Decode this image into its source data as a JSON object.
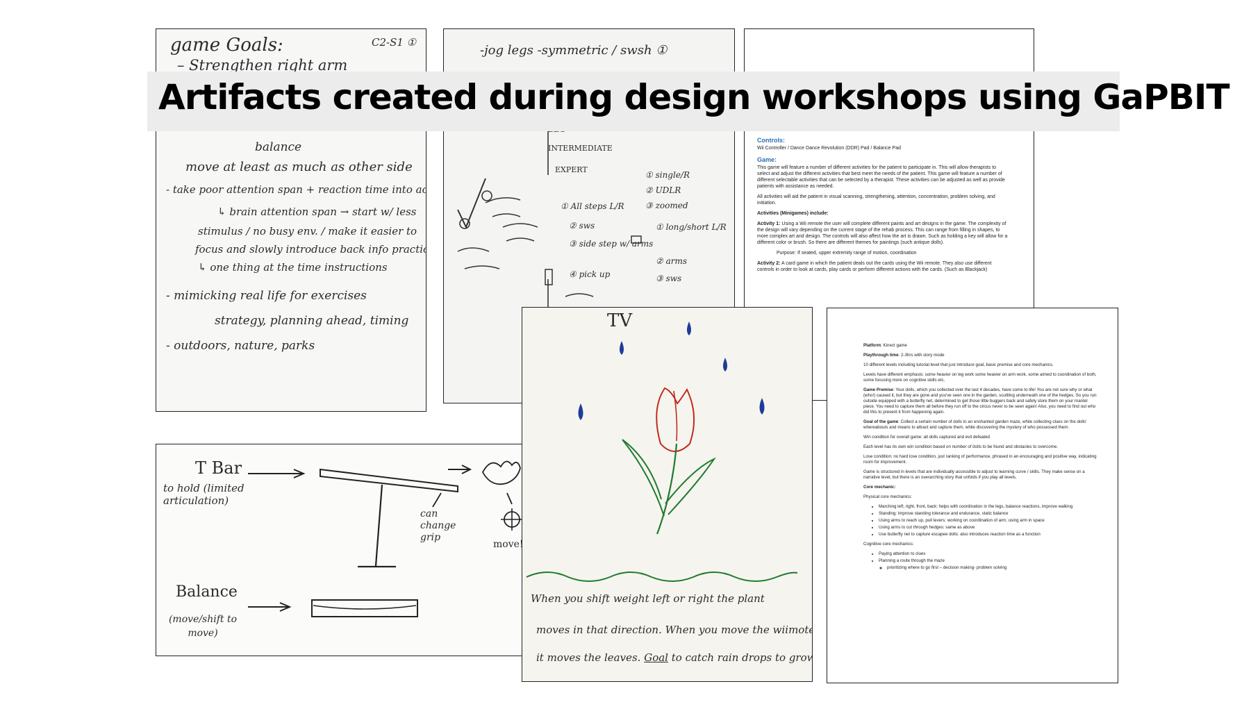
{
  "title": "Artifacts created during design workshops using GaPBIT",
  "panel1": {
    "lines": [
      "game Goals:",
      "C2-S1 ①",
      "– Strengthen right arm",
      "balance",
      "move at least as much as other side",
      "- take poor attention span + reaction time into account",
      "↳ brain attention span → start w/ less",
      "stimulus / no busy env. / make it easier to",
      "focus and slowly introduce back info practice",
      "↳ one thing at the time instructions",
      "- mimicking real life for exercises",
      "strategy, planning ahead, timing",
      "- outdoors, nature, parks"
    ]
  },
  "panel2": {
    "lines": [
      "-jog legs -symmetric / swsh ①",
      "BEG",
      "INTERMEDIATE",
      "EXPERT",
      "① All steps L/R",
      "② sws",
      "③ side step w/ arms",
      "④ pick up",
      "① single/R",
      "② UDLR",
      "③ zoomed",
      "① long/short L/R",
      "② arms",
      "③ sws"
    ]
  },
  "doc1": {
    "controls_heading": "Controls:",
    "controls_text": "Wii Controller / Dance Dance Revolution (DDR) Pad / Balance Pad",
    "game_heading": "Game:",
    "p1": "This game will feature a number of different activities for the patient to participate in. This will allow therapists to select and adjust the different activities that best meet the needs of the patient. This game will feature a number of different selectable activities that can be selected by a therapist. These activities can be adjusted as well as provide patients with assistance as needed.",
    "p2": "All activities will aid the patient in visual scanning, strengthening, attention, concentration, problem solving, and initiation.",
    "p3": "Activities (Minigames) include:",
    "p4_label": "Activity 1:",
    "p4": " Using a Wii remote the user will complete different paints and art designs in the game. The complexity of the design will vary depending on the current stage of the rehab process. This can range from filling in shapes, to more complex art and design. The controls will also affect how the art is drawn. Such as holding a key will allow for a different color or brush. So there are different themes for paintings (such antique dolls).",
    "p5": "Purpose: If seated, upper extremity range of motion, coordination",
    "p6_label": "Activity 2:",
    "p6": " A card game in which the patient deals out the cards using the Wii remote. They also use different controls in order to look at cards, play cards or perform different actions with the cards. (Such as Blackjack)"
  },
  "panel4": {
    "tbar_label": "T Bar",
    "tbar_note": "to hold (limited articulation)",
    "grip_note": "can change grip",
    "move_note": "move!",
    "balance_label": "Balance",
    "balance_note": "(move/shift to move)"
  },
  "panel5": {
    "tv_label": "TV",
    "caption_line1": "When you shift weight left or right the plant",
    "caption_line2": "moves in that direction. When you move the wiimote",
    "caption_line3_pre": "it moves the leaves.",
    "caption_goal": "Goal",
    "caption_line3_post": "to catch rain drops to grow"
  },
  "doc2": {
    "platform_label": "Platform",
    "platform": ": Kinect game",
    "playthrough_label": "Playthrough time",
    "playthrough": ": 2-3hrs with story mode",
    "p1": "10 different levels including tutorial level that just introduce goal, basic premise and core mechanics.",
    "p2": "Levels have different emphasis: some heavier on leg work some heavier on arm work, some aimed to coordination of both, some focusing more on cognitive skills etc.",
    "premise_label": "Game Premise",
    "premise": ": Your dolls, which you collected over the last 4 decades, have come to life! You are not sure why or what (who!) caused it, but they are gone and you've seen one in the garden, scuttling underneath one of the hedges. So you run outside equipped with a butterfly net, determined to get those little buggers back and safely store them on your mantel piece. You need to capture them all before they run off to the circus never to be seen again! Also, you need to find out who did this to prevent it from happening again.",
    "goal_label": "Goal of the game",
    "goal": ":  Collect a certain number of dolls in an enchanted garden maze, while collecting clues on the dolls' whereabouts and means to attract and capture them, while discovering the mystery of who possessed them.",
    "win": "Win condition for overall game: all dolls captured and evil defeated",
    "level": "Each level has its own win condition based on number of dolls to be found and obstacles to overcome.",
    "lose": "Lose condition: no hard lose condition, just ranking of performance, phrased in an encouraging and positive way, indicating room for improvement.",
    "structure": "Game is structured in levels that are individually accessible to adjust to learning curve / skills. They make sense on a narrative level, but there is an overarching story that unfolds if you play all levels.",
    "core_label": "Core mechanic:",
    "physical_label": "Physical core mechanics:",
    "physical": [
      "Marching left, right, front, back: helps with coordination in the legs, balance reactions, improve walking",
      "Standing: improve standing tolerance and endurance, static balance",
      "Using arms to reach up, pull levers: working on coordination of arm, using arm in space",
      "Using arms to cut through hedges: same as above",
      "Use butterfly net to capture escapee dolls: also introduces reaction time as a function"
    ],
    "cognitive_label": "Cognitive core mechanics:",
    "cognitive": [
      "Paying attention to clues",
      "Planning a route through the maze"
    ],
    "cognitive_sub": "prioritizing where to go first – decision making- problem solving"
  }
}
